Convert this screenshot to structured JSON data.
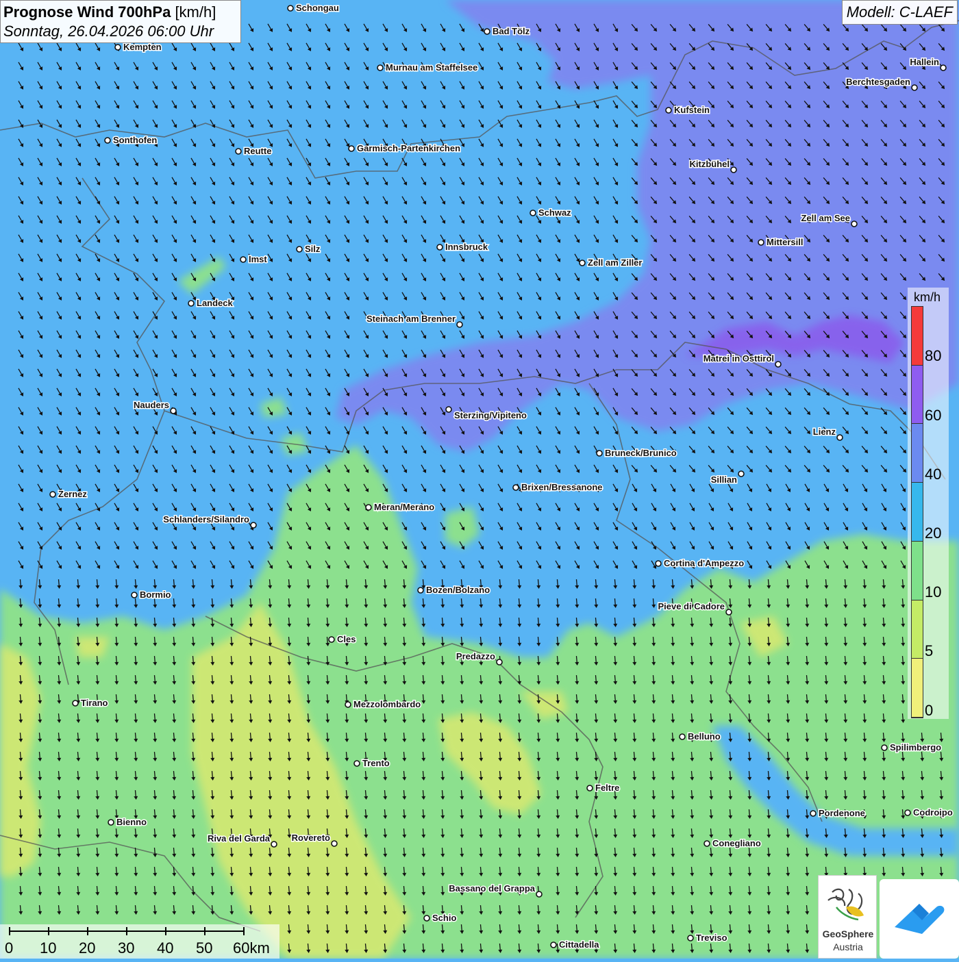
{
  "title": {
    "main": "Prognose Wind 700hPa",
    "unit": "[km/h]",
    "datetime": "Sonntag, 26.04.2026 06:00 Uhr"
  },
  "model": "Modell: C-LAEF",
  "legend": {
    "unit": "km/h",
    "labels": [
      "80",
      "60",
      "40",
      "20",
      "10",
      "5",
      "0"
    ],
    "colors": [
      "#f53a3a",
      "#8e5cf0",
      "#6b8af0",
      "#36b8ec",
      "#7ee08a",
      "#c4ec66",
      "#f0f07a"
    ]
  },
  "scalebar": {
    "labels": [
      "0",
      "10",
      "20",
      "30",
      "40",
      "50",
      "60km"
    ]
  },
  "logos": {
    "geosphere_line1": "GeoSphere",
    "geosphere_line2": "Austria"
  },
  "map_colors": {
    "strong_wind": "#8a5cec",
    "high_wind": "#7a8af0",
    "medium_wind": "#58b4f4",
    "low_wind": "#8ce08e",
    "calm": "#d4e872"
  },
  "wind_direction": "north-northwest to south-southeast",
  "cities": [
    "Schongau",
    "Bad Tölz",
    "Kempten",
    "Murnau am Staffelsee",
    "Hallein",
    "Berchtesgaden",
    "Kufstein",
    "Sonthofen",
    "Reutte",
    "Garmisch-Partenkirchen",
    "Kitzbühel",
    "Schwaz",
    "Zell am See",
    "Mittersill",
    "Innsbruck",
    "Silz",
    "Imst",
    "Zell am Ziller",
    "Landeck",
    "Steinach am Brenner",
    "Matrei in Osttirol",
    "Nauders",
    "Sterzing/Vipiteno",
    "Lienz",
    "Bruneck/Brunico",
    "Sillian",
    "Zernez",
    "Brixen/Bressanone",
    "Meran/Merano",
    "Schlanders/Silandro",
    "Cortina d'Ampezzo",
    "Bozen/Bolzano",
    "Bormio",
    "Pieve di Cadore",
    "Cles",
    "Predazzo",
    "Tirano",
    "Mezzolombardo",
    "Belluno",
    "Spilimbergo",
    "Trento",
    "Feltre",
    "Bienno",
    "Pordenone",
    "Codroipo",
    "Riva del Garda",
    "Rovereto",
    "Conegliano",
    "Bassano del Grappa",
    "Schio",
    "Treviso",
    "Cittadella"
  ]
}
